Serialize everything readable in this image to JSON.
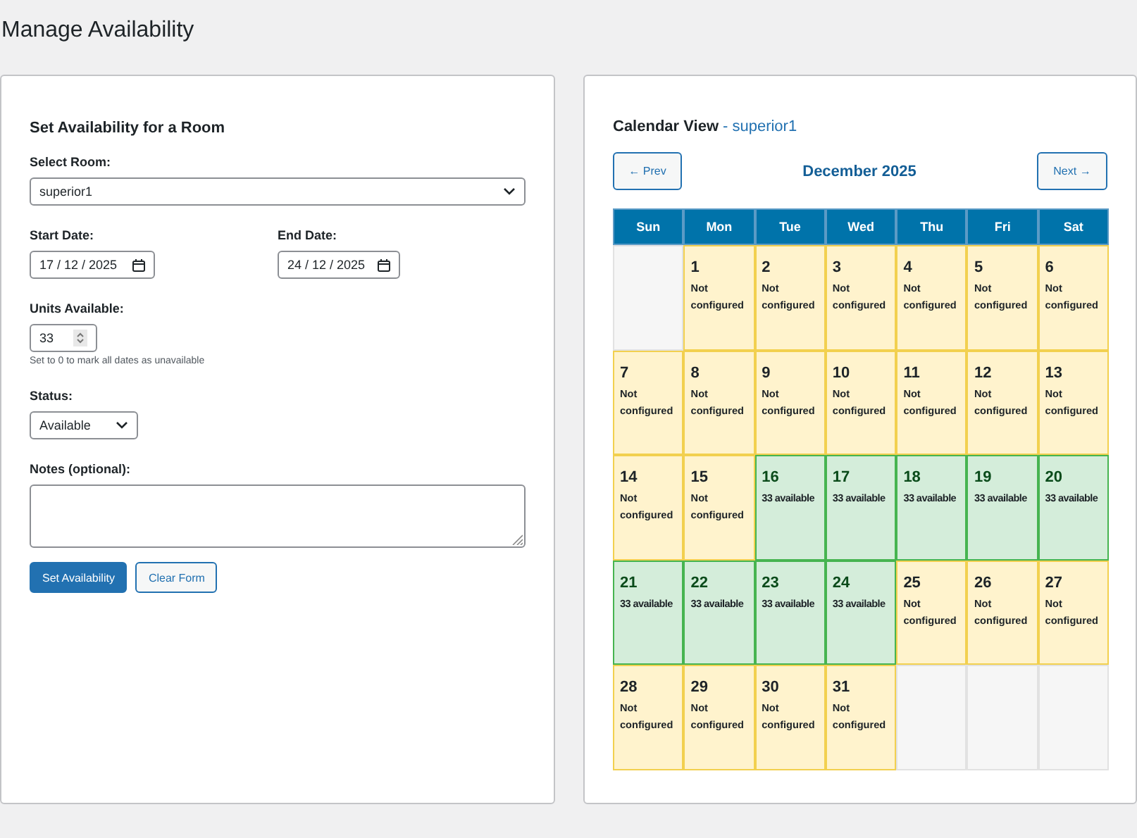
{
  "page_title": "Manage Availability",
  "form": {
    "heading": "Set Availability for a Room",
    "room_label": "Select Room:",
    "room_value": "superior1",
    "start_label": "Start Date:",
    "start_value": "17 / 12 / 2025",
    "end_label": "End Date:",
    "end_value": "24 / 12 / 2025",
    "units_label": "Units Available:",
    "units_value": "33",
    "units_hint": "Set to 0 to mark all dates as unavailable",
    "status_label": "Status:",
    "status_value": "Available",
    "notes_label": "Notes (optional):",
    "buttons": [
      {
        "label": "Set Availability",
        "kind": "primary"
      },
      {
        "label": "Clear Form",
        "kind": "secondary"
      }
    ]
  },
  "calendar": {
    "heading": "Calendar View",
    "room": "- superior1",
    "prev": "← Prev",
    "next": "Next →",
    "month": "December 2025",
    "weekdays": [
      "Sun",
      "Mon",
      "Tue",
      "Wed",
      "Thu",
      "Fri",
      "Sat"
    ],
    "weeks": [
      [
        {
          "kind": "blank"
        },
        {
          "kind": "day",
          "day": "1",
          "note": "Not configured",
          "available": false
        },
        {
          "kind": "day",
          "day": "2",
          "note": "Not configured",
          "available": false
        },
        {
          "kind": "day",
          "day": "3",
          "note": "Not configured",
          "available": false
        },
        {
          "kind": "day",
          "day": "4",
          "note": "Not configured",
          "available": false
        },
        {
          "kind": "day",
          "day": "5",
          "note": "Not configured",
          "available": false
        },
        {
          "kind": "day",
          "day": "6",
          "note": "Not configured",
          "available": false
        }
      ],
      [
        {
          "kind": "day",
          "day": "7",
          "note": "Not configured",
          "available": false
        },
        {
          "kind": "day",
          "day": "8",
          "note": "Not configured",
          "available": false
        },
        {
          "kind": "day",
          "day": "9",
          "note": "Not configured",
          "available": false
        },
        {
          "kind": "day",
          "day": "10",
          "note": "Not configured",
          "available": false
        },
        {
          "kind": "day",
          "day": "11",
          "note": "Not configured",
          "available": false
        },
        {
          "kind": "day",
          "day": "12",
          "note": "Not configured",
          "available": false
        },
        {
          "kind": "day",
          "day": "13",
          "note": "Not configured",
          "available": false
        }
      ],
      [
        {
          "kind": "day",
          "day": "14",
          "note": "Not configured",
          "available": false
        },
        {
          "kind": "day",
          "day": "15",
          "note": "Not configured",
          "available": false
        },
        {
          "kind": "day",
          "day": "16",
          "note": "33 available",
          "available": true
        },
        {
          "kind": "day",
          "day": "17",
          "note": "33 available",
          "available": true
        },
        {
          "kind": "day",
          "day": "18",
          "note": "33 available",
          "available": true
        },
        {
          "kind": "day",
          "day": "19",
          "note": "33 available",
          "available": true
        },
        {
          "kind": "day",
          "day": "20",
          "note": "33 available",
          "available": true
        }
      ],
      [
        {
          "kind": "day",
          "day": "21",
          "note": "33 available",
          "available": true
        },
        {
          "kind": "day",
          "day": "22",
          "note": "33 available",
          "available": true
        },
        {
          "kind": "day",
          "day": "23",
          "note": "33 available",
          "available": true
        },
        {
          "kind": "day",
          "day": "24",
          "note": "33 available",
          "available": true
        },
        {
          "kind": "day",
          "day": "25",
          "note": "Not configured",
          "available": false
        },
        {
          "kind": "day",
          "day": "26",
          "note": "Not configured",
          "available": false
        },
        {
          "kind": "day",
          "day": "27",
          "note": "Not configured",
          "available": false
        }
      ],
      [
        {
          "kind": "day",
          "day": "28",
          "note": "Not configured",
          "available": false
        },
        {
          "kind": "day",
          "day": "29",
          "note": "Not configured",
          "available": false
        },
        {
          "kind": "day",
          "day": "30",
          "note": "Not configured",
          "available": false
        },
        {
          "kind": "day",
          "day": "31",
          "note": "Not configured",
          "available": false
        },
        {
          "kind": "blank"
        },
        {
          "kind": "blank"
        },
        {
          "kind": "blank"
        }
      ]
    ]
  }
}
